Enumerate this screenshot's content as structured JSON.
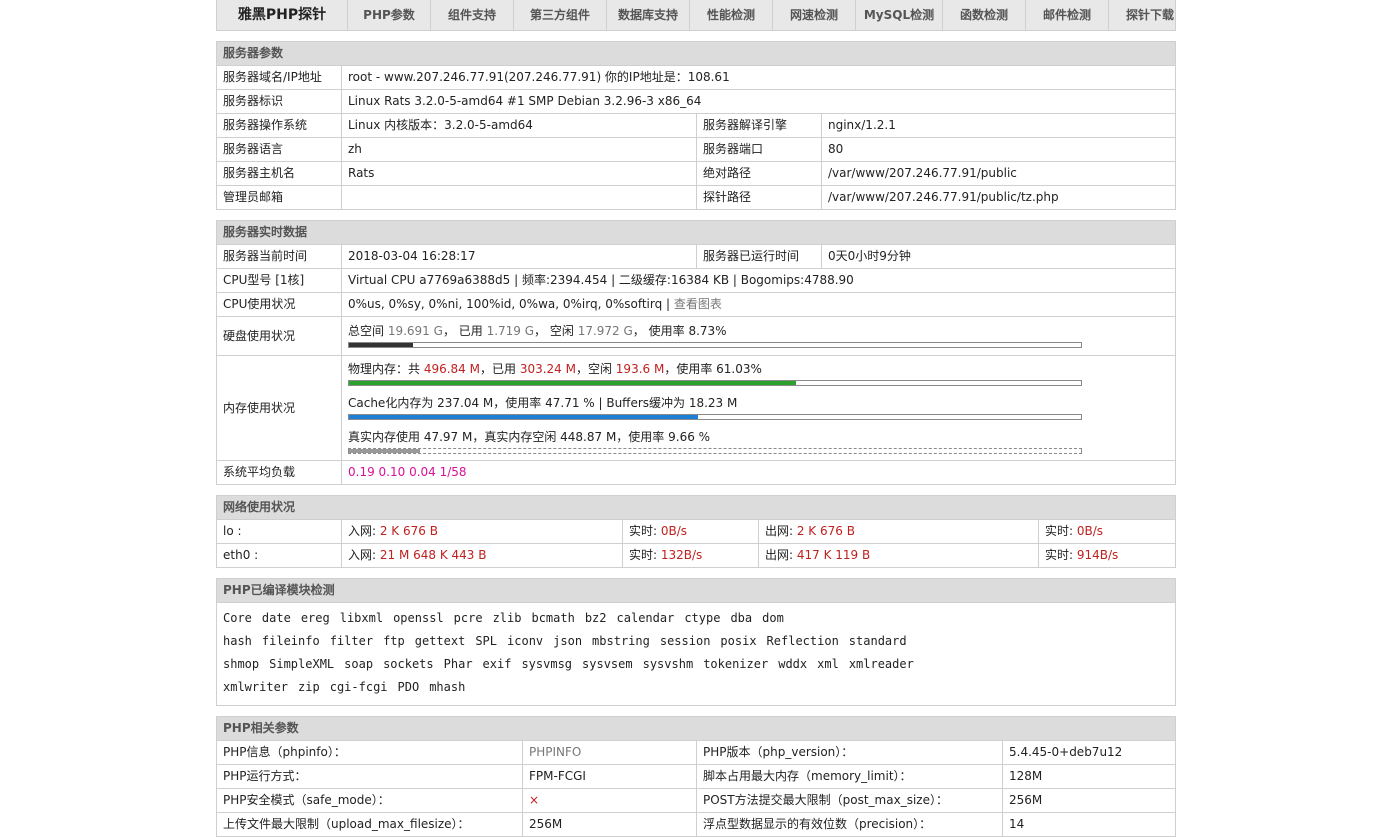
{
  "nav": [
    {
      "label": "雅黑PHP探针",
      "brand": true
    },
    {
      "label": "PHP参数"
    },
    {
      "label": "组件支持"
    },
    {
      "label": "第三方组件"
    },
    {
      "label": "数据库支持"
    },
    {
      "label": "性能检测"
    },
    {
      "label": "网速检测"
    },
    {
      "label": "MySQL检测"
    },
    {
      "label": "函数检测"
    },
    {
      "label": "邮件检测"
    },
    {
      "label": "探针下载"
    }
  ],
  "server_params": {
    "title": "服务器参数",
    "domain_label": "服务器域名/IP地址",
    "domain_value": "root - www.207.246.77.91(207.246.77.91)  你的IP地址是：108.61",
    "id_label": "服务器标识",
    "id_value": "Linux Rats 3.2.0-5-amd64 #1 SMP Debian 3.2.96-3 x86_64",
    "os_label": "服务器操作系统",
    "os_value": "Linux  内核版本：3.2.0-5-amd64",
    "engine_label": "服务器解译引擎",
    "engine_value": "nginx/1.2.1",
    "lang_label": "服务器语言",
    "lang_value": "zh",
    "port_label": "服务器端口",
    "port_value": "80",
    "host_label": "服务器主机名",
    "host_value": "Rats",
    "abspath_label": "绝对路径",
    "abspath_value": "/var/www/207.246.77.91/public",
    "admin_label": "管理员邮箱",
    "admin_value": "",
    "probepath_label": "探针路径",
    "probepath_value": "/var/www/207.246.77.91/public/tz.php"
  },
  "realtime": {
    "title": "服务器实时数据",
    "time_label": "服务器当前时间",
    "time_value": "2018-03-04 16:28:17",
    "uptime_label": "服务器已运行时间",
    "uptime_value": "0天0小时9分钟",
    "cpu_label": "CPU型号 [1核]",
    "cpu_value": "Virtual CPU a7769a6388d5 | 频率:2394.454 | 二级缓存:16384 KB | Bogomips:4788.90",
    "cpuuse_label": "CPU使用状况",
    "cpuuse_value": "0%us, 0%sy, 0%ni, 100%id, 0%wa, 0%irq, 0%softirq | ",
    "cpuuse_link": "查看图表",
    "disk_label": "硬盘使用状况",
    "disk": {
      "t1": "总空间 ",
      "total": "19.691 G",
      "t2": "，  已用 ",
      "used": "1.719 G",
      "t3": "，  空闲 ",
      "free": "17.972 G",
      "t4": "，  使用率 ",
      "rate": "8.73%",
      "pct": 8.73,
      "color": "#333333"
    },
    "mem_label": "内存使用状况",
    "mem": {
      "t1": "物理内存：共 ",
      "total": "496.84 M",
      "t2": "，已用 ",
      "used": "303.24 M",
      "t3": "，空闲 ",
      "free": "193.6 M",
      "t4": "，使用率 ",
      "rate": "61.03%",
      "pct": 61.03,
      "color": "#2ca02c"
    },
    "cache": {
      "text": "Cache化内存为 237.04 M，使用率 47.71 % | Buffers缓冲为 18.23 M",
      "pct": 47.71,
      "color": "#1e7fd6"
    },
    "real": {
      "text": "真实内存使用 47.97 M，真实内存空闲 448.87 M，使用率 9.66 %",
      "pct": 9.66,
      "color": "#999999"
    },
    "load_label": "系统平均负载",
    "load_value": "0.19 0.10 0.04 1/58",
    "load_color": "#d6119a"
  },
  "network": {
    "title": "网络使用状况",
    "rows": [
      {
        "iface": "lo :",
        "in_label": "入网: ",
        "in": "2 K 676 B",
        "rt_in_label": "实时: ",
        "rt_in": "0B/s",
        "out_label": "出网: ",
        "out": "2 K 676 B",
        "rt_out_label": "实时: ",
        "rt_out": "0B/s"
      },
      {
        "iface": "eth0 :",
        "in_label": "入网: ",
        "in": "21 M 648 K 443 B",
        "rt_in_label": "实时: ",
        "rt_in": "132B/s",
        "out_label": "出网: ",
        "out": "417 K 119 B",
        "rt_out_label": "实时: ",
        "rt_out": "914B/s"
      }
    ]
  },
  "modules": {
    "title": "PHP已编译模块检测",
    "lines": [
      [
        "Core",
        "date",
        "ereg",
        "libxml",
        "openssl",
        "pcre",
        "zlib",
        "bcmath",
        "bz2",
        "calendar",
        "ctype",
        "dba",
        "dom"
      ],
      [
        "hash",
        "fileinfo",
        "filter",
        "ftp",
        "gettext",
        "SPL",
        "iconv",
        "json",
        "mbstring",
        "session",
        "posix",
        "Reflection",
        "standard"
      ],
      [
        "shmop",
        "SimpleXML",
        "soap",
        "sockets",
        "Phar",
        "exif",
        "sysvmsg",
        "sysvsem",
        "sysvshm",
        "tokenizer",
        "wddx",
        "xml",
        "xmlreader"
      ],
      [
        "xmlwriter",
        "zip",
        "cgi-fcgi",
        "PDO",
        "mhash"
      ]
    ]
  },
  "php": {
    "title": "PHP相关参数",
    "rows": [
      {
        "l1": "PHP信息（phpinfo）：",
        "v1": "PHPINFO",
        "v1_class": "gray",
        "l2": "PHP版本（php_version）：",
        "v2": "5.4.45-0+deb7u12"
      },
      {
        "l1": "PHP运行方式：",
        "v1": "FPM-FCGI",
        "v1_class": "",
        "l2": "脚本占用最大内存（memory_limit）：",
        "v2": "128M"
      },
      {
        "l1": "PHP安全模式（safe_mode）：",
        "v1": "×",
        "v1_class": "red",
        "l2": "POST方法提交最大限制（post_max_size）：",
        "v2": "256M"
      },
      {
        "l1": "上传文件最大限制（upload_max_filesize）：",
        "v1": "256M",
        "v1_class": "",
        "l2": "浮点型数据显示的有效位数（precision）：",
        "v2": "14"
      }
    ]
  }
}
